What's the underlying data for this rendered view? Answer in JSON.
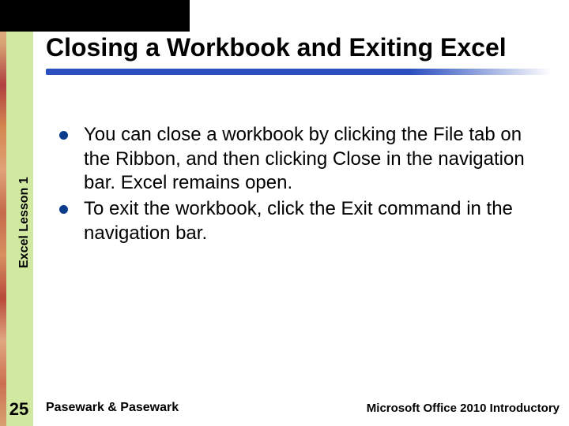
{
  "title": "Closing a Workbook and Exiting Excel",
  "sidebar_label": "Excel Lesson 1",
  "page_number": "25",
  "bullets": [
    "You can close a workbook by clicking the File tab on the Ribbon, and then clicking Close in the navigation bar. Excel remains open.",
    "To exit the workbook, click the Exit command in the navigation bar."
  ],
  "footer": {
    "left": "Pasewark & Pasewark",
    "right": "Microsoft Office 2010 Introductory"
  }
}
